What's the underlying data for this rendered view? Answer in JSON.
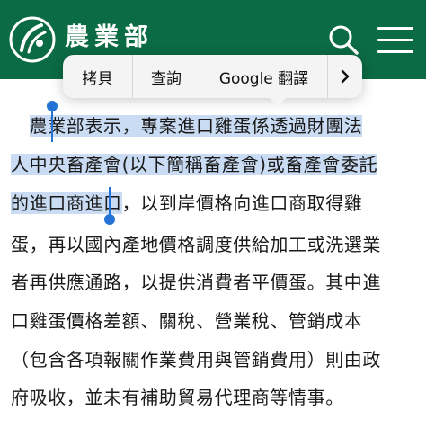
{
  "header": {
    "site_title": "農業部",
    "logo_icon": "moa-logo-icon",
    "search_icon": "search-icon",
    "menu_icon": "hamburger-menu-icon",
    "background_color": "#0b6b44"
  },
  "context_menu": {
    "copy_label": "拷貝",
    "lookup_label": "查詢",
    "translate_label": "Google 翻譯",
    "more_label": "›",
    "more_icon": "chevron-right-icon"
  },
  "article": {
    "line1_pre": "　",
    "line1_sel": "農業部表示，專案進口雞蛋係透過財團法",
    "line2_sel": "人中央畜產會(以下簡稱畜產會)或畜產會委託",
    "line3_sel": "的進口商進口",
    "line3_post": "，以到岸價格向進口商取得雞",
    "line4": "蛋，再以國內產地價格調度供給加工或洗選業",
    "line5": "者再供應通路，以提供消費者平價蛋。其中進",
    "line6": "口雞蛋價格差額、關稅、營業稅、管銷成本",
    "line7": "（包含各項報關作業費用與管銷費用）則由政",
    "line8": "府吸收，並未有補助貿易代理商等情事。"
  },
  "selection": {
    "highlight_color": "#c9dcf3",
    "handle_color": "#2472d6"
  }
}
